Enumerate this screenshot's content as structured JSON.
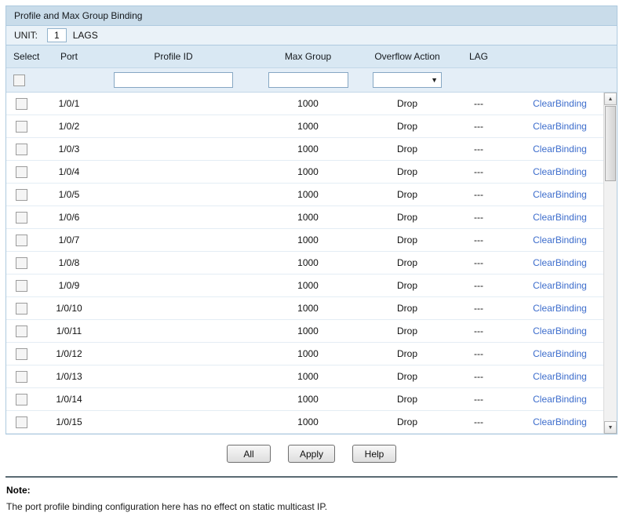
{
  "panel": {
    "title": "Profile and Max Group Binding",
    "unit_label": "UNIT:",
    "unit_selected": "1",
    "lags_label": "LAGS"
  },
  "table": {
    "headers": [
      "Select",
      "Port",
      "Profile ID",
      "Max Group",
      "Overflow Action",
      "LAG",
      ""
    ],
    "filters": {
      "profile_id_value": "",
      "max_group_value": "",
      "overflow_action_selected": ""
    },
    "rows": [
      {
        "port": "1/0/1",
        "profile_id": "",
        "max_group": "1000",
        "overflow_action": "Drop",
        "lag": "---",
        "action": "ClearBinding"
      },
      {
        "port": "1/0/2",
        "profile_id": "",
        "max_group": "1000",
        "overflow_action": "Drop",
        "lag": "---",
        "action": "ClearBinding"
      },
      {
        "port": "1/0/3",
        "profile_id": "",
        "max_group": "1000",
        "overflow_action": "Drop",
        "lag": "---",
        "action": "ClearBinding"
      },
      {
        "port": "1/0/4",
        "profile_id": "",
        "max_group": "1000",
        "overflow_action": "Drop",
        "lag": "---",
        "action": "ClearBinding"
      },
      {
        "port": "1/0/5",
        "profile_id": "",
        "max_group": "1000",
        "overflow_action": "Drop",
        "lag": "---",
        "action": "ClearBinding"
      },
      {
        "port": "1/0/6",
        "profile_id": "",
        "max_group": "1000",
        "overflow_action": "Drop",
        "lag": "---",
        "action": "ClearBinding"
      },
      {
        "port": "1/0/7",
        "profile_id": "",
        "max_group": "1000",
        "overflow_action": "Drop",
        "lag": "---",
        "action": "ClearBinding"
      },
      {
        "port": "1/0/8",
        "profile_id": "",
        "max_group": "1000",
        "overflow_action": "Drop",
        "lag": "---",
        "action": "ClearBinding"
      },
      {
        "port": "1/0/9",
        "profile_id": "",
        "max_group": "1000",
        "overflow_action": "Drop",
        "lag": "---",
        "action": "ClearBinding"
      },
      {
        "port": "1/0/10",
        "profile_id": "",
        "max_group": "1000",
        "overflow_action": "Drop",
        "lag": "---",
        "action": "ClearBinding"
      },
      {
        "port": "1/0/11",
        "profile_id": "",
        "max_group": "1000",
        "overflow_action": "Drop",
        "lag": "---",
        "action": "ClearBinding"
      },
      {
        "port": "1/0/12",
        "profile_id": "",
        "max_group": "1000",
        "overflow_action": "Drop",
        "lag": "---",
        "action": "ClearBinding"
      },
      {
        "port": "1/0/13",
        "profile_id": "",
        "max_group": "1000",
        "overflow_action": "Drop",
        "lag": "---",
        "action": "ClearBinding"
      },
      {
        "port": "1/0/14",
        "profile_id": "",
        "max_group": "1000",
        "overflow_action": "Drop",
        "lag": "---",
        "action": "ClearBinding"
      },
      {
        "port": "1/0/15",
        "profile_id": "",
        "max_group": "1000",
        "overflow_action": "Drop",
        "lag": "---",
        "action": "ClearBinding"
      }
    ]
  },
  "buttons": {
    "all": "All",
    "apply": "Apply",
    "help": "Help"
  },
  "icons": {
    "dropdown_arrow": "▼",
    "scroll_up": "▲",
    "scroll_down": "▼"
  },
  "note": {
    "label": "Note:",
    "text": "The port profile binding configuration here has no effect on static multicast IP."
  }
}
